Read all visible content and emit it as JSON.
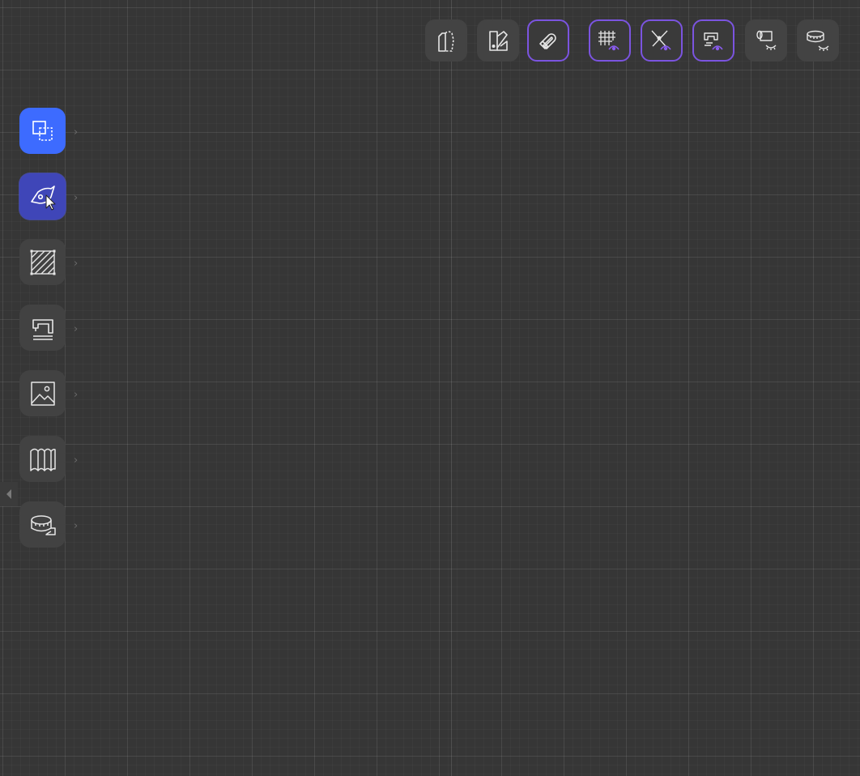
{
  "theme": {
    "canvas_bg": "#363636",
    "button_bg": "#434343",
    "active_outline": "#7b54e0",
    "selected_tool_bg": "#3d6bff",
    "pen_tool_bg": "#3f46b8",
    "icon_stroke": "#e6e6e6"
  },
  "top_toolbar": {
    "buttons": [
      {
        "icon": "pattern-piece-icon",
        "active": false
      },
      {
        "icon": "color-swatch-icon",
        "active": false
      },
      {
        "icon": "magnet-snap-icon",
        "active": true
      },
      {
        "icon": "grid-visibility-icon",
        "active": true
      },
      {
        "icon": "points-visibility-icon",
        "active": true
      },
      {
        "icon": "sewing-visibility-icon",
        "active": true
      },
      {
        "icon": "fabric-hidden-icon",
        "active": false
      },
      {
        "icon": "measure-hidden-icon",
        "active": false
      }
    ]
  },
  "left_toolbar": {
    "tools": [
      {
        "icon": "select-transform-icon",
        "state": "selected"
      },
      {
        "icon": "pen-tool-icon",
        "state": "hovered"
      },
      {
        "icon": "hatch-fill-icon",
        "state": "normal"
      },
      {
        "icon": "sewing-machine-icon",
        "state": "normal"
      },
      {
        "icon": "image-icon",
        "state": "normal"
      },
      {
        "icon": "map-fold-icon",
        "state": "normal"
      },
      {
        "icon": "tape-measure-icon",
        "state": "normal"
      }
    ],
    "collapse_icon": "caret-left-icon"
  }
}
